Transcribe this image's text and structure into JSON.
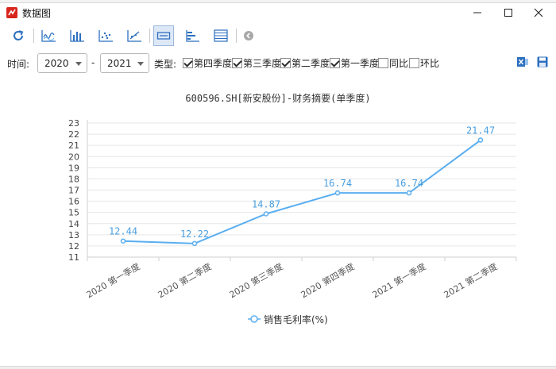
{
  "window": {
    "title": "数据图"
  },
  "filters": {
    "time_label": "时间:",
    "from_year": "2020",
    "dash": "-",
    "to_year": "2021",
    "type_label": "类型:",
    "checkboxes": [
      {
        "label": "第四季度",
        "checked": true
      },
      {
        "label": "第三季度",
        "checked": true
      },
      {
        "label": "第二季度",
        "checked": true
      },
      {
        "label": "第一季度",
        "checked": true
      },
      {
        "label": "同比",
        "checked": false
      },
      {
        "label": "环比",
        "checked": false
      }
    ]
  },
  "colors": {
    "line": "#5aaef0",
    "label": "#4a9fe0",
    "accent": "#2c6fbf"
  },
  "chart_data": {
    "type": "line",
    "title": "600596.SH[新安股份]-财务摘要(单季度)",
    "categories": [
      "2020 第一季度",
      "2020 第二季度",
      "2020 第三季度",
      "2020 第四季度",
      "2021 第一季度",
      "2021 第二季度"
    ],
    "series": [
      {
        "name": "销售毛利率(%)",
        "values": [
          12.44,
          12.22,
          14.87,
          16.74,
          16.74,
          21.47
        ]
      }
    ],
    "data_labels": [
      "12.44",
      "12.22",
      "14.87",
      "16.74",
      "16.74",
      "21.47"
    ],
    "ylim": [
      11,
      23
    ],
    "yticks": [
      "11",
      "12",
      "13",
      "14",
      "15",
      "16",
      "17",
      "18",
      "19",
      "20",
      "21",
      "22",
      "23"
    ],
    "grid": true,
    "legend_position": "bottom"
  }
}
